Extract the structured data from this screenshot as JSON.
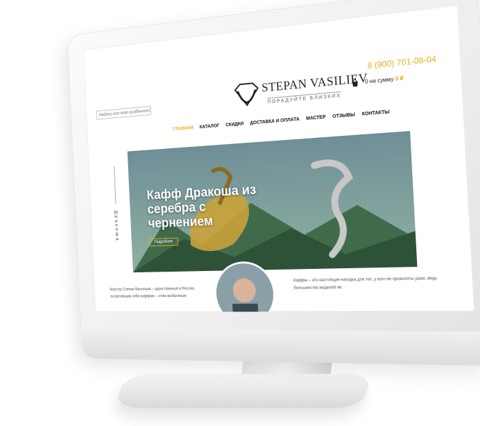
{
  "header": {
    "search_placeholder": "Найти кое-что особенное?",
    "brand": "STEPAN VASILIEV",
    "tagline": "ПОРАДУЙТЕ БЛИЗКИХ",
    "phone": "8 (900) 701-08-04",
    "cart_label": "0 на сумму",
    "cart_sum": "0 ₽"
  },
  "nav": {
    "items": [
      "ГЛАВНАЯ",
      "КАТАЛОГ",
      "СКИДКИ",
      "ДОСТАВКА И ОПЛАТА",
      "МАСТЕР",
      "ОТЗЫВЫ",
      "КОНТАКТЫ"
    ],
    "active_index": 0
  },
  "hero": {
    "side_label": "Дракоша",
    "title": "Кафф Дракоша из серебра с чернением",
    "button": "Подробнее"
  },
  "content": {
    "left_text": "Мастер Степан Васильев – единственный в России, посвятивший себя каффам – этим необычным",
    "right_text": "Каффы – это настоящая находка для тех, у кого не проколоты ушки, ведь большинство моделей не"
  },
  "colors": {
    "accent": "#e3b11b",
    "text": "#111111",
    "muted": "#555555"
  },
  "icons": {
    "cart": "shopping-bag-icon",
    "logo": "diamond-logo-icon"
  }
}
